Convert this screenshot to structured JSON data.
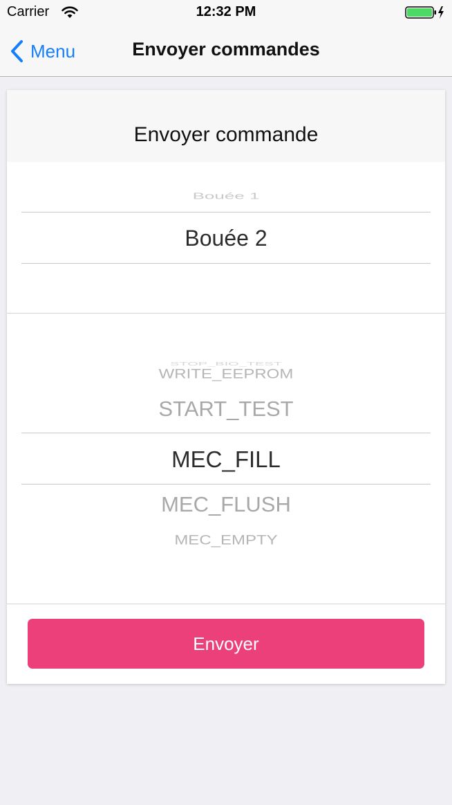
{
  "status_bar": {
    "carrier": "Carrier",
    "time": "12:32 PM",
    "icons": [
      "wifi-icon",
      "battery-charging-icon"
    ]
  },
  "nav_bar": {
    "back_label": "Menu",
    "back_icon": "chevron-left-icon",
    "title": "Envoyer commandes"
  },
  "card": {
    "title": "Envoyer commande",
    "buoy_picker": {
      "items": [
        "Bouée 1",
        "Bouée 2"
      ],
      "selected": "Bouée 2"
    },
    "command_picker": {
      "items": [
        "STOP_BIO_TEST",
        "WRITE_EEPROM",
        "START_TEST",
        "MEC_FILL",
        "MEC_FLUSH",
        "MEC_EMPTY"
      ],
      "selected": "MEC_FILL"
    },
    "send_button_label": "Envoyer"
  },
  "colors": {
    "accent_blue": "#147efb",
    "button_pink": "#ec407a",
    "background": "#efeff4"
  }
}
